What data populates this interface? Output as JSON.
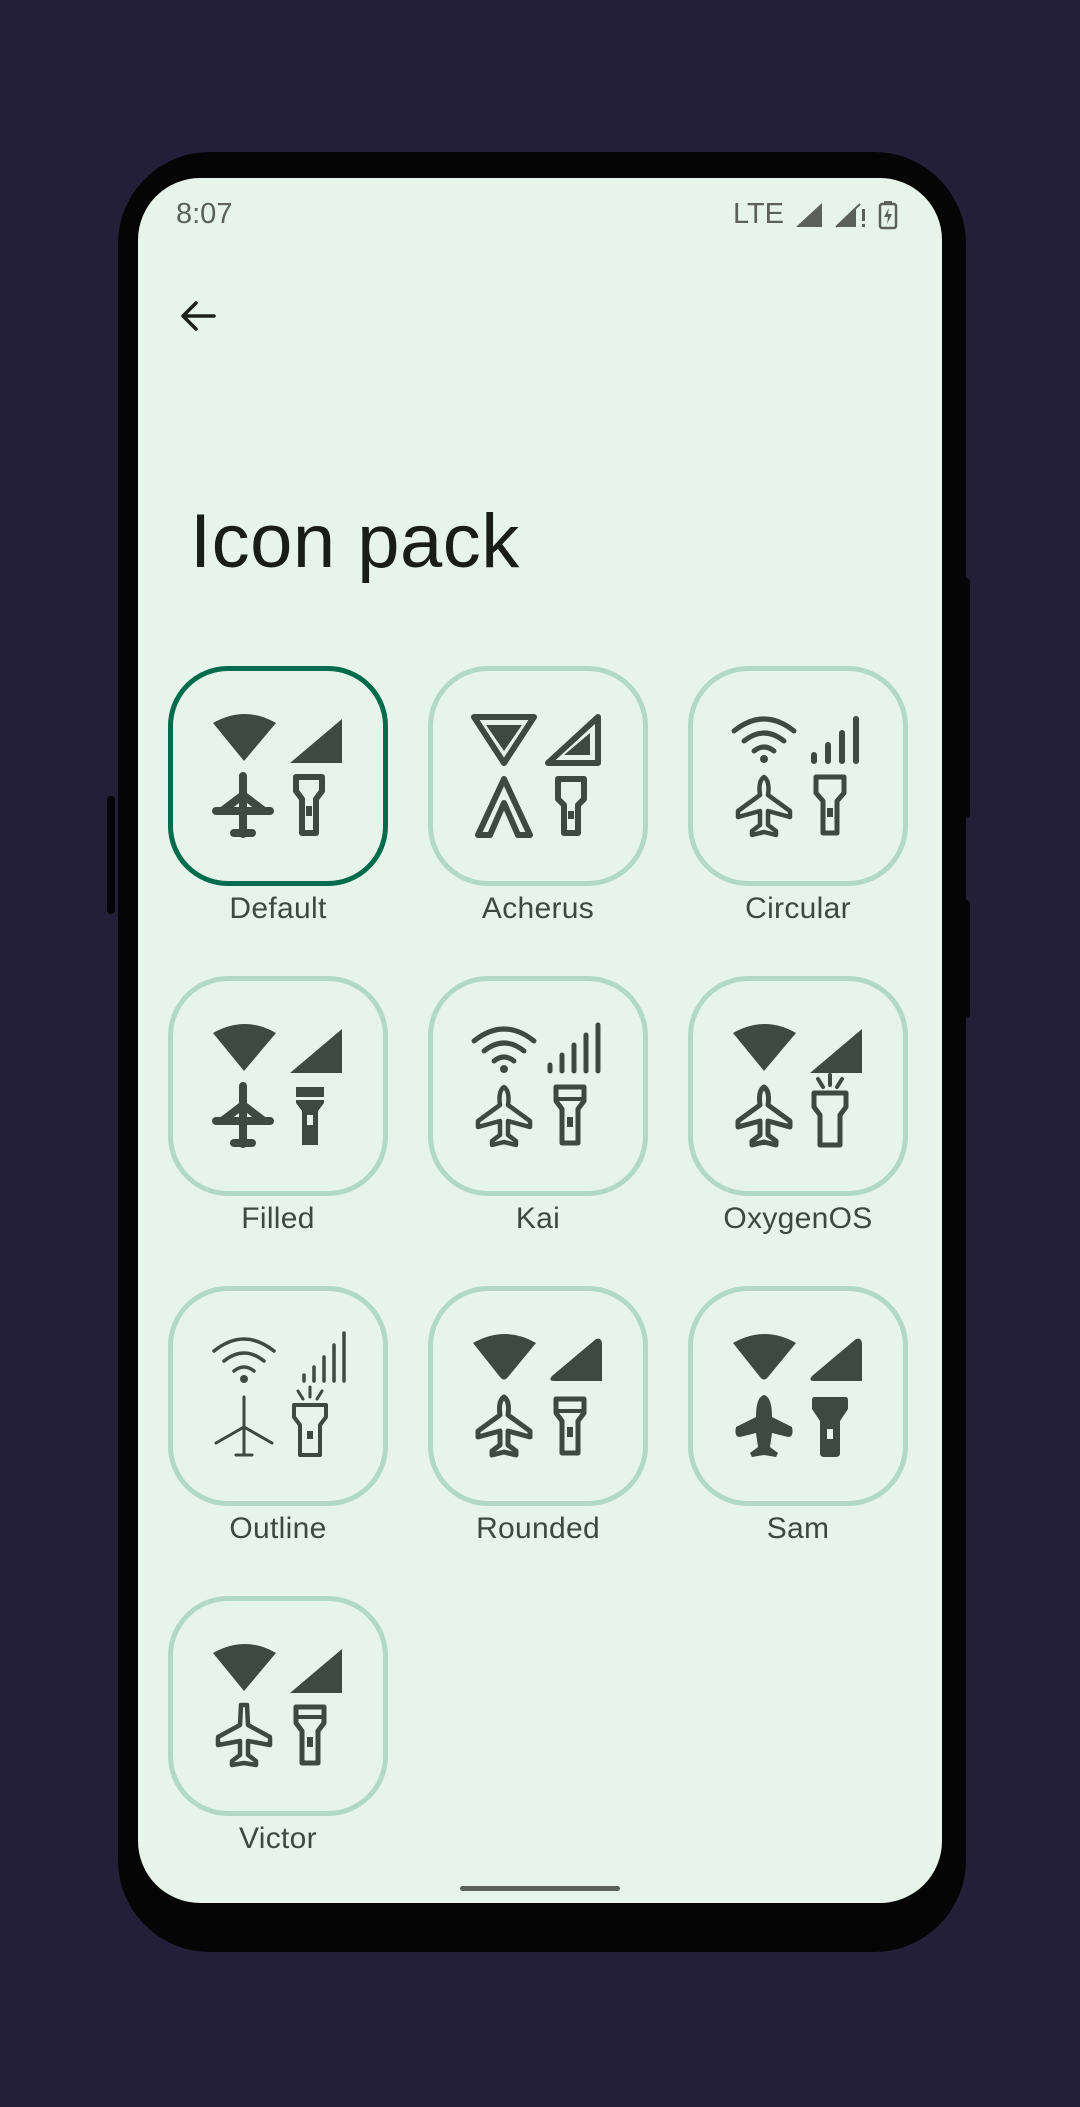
{
  "status_bar": {
    "time": "8:07",
    "network": "LTE",
    "icons": [
      "signal-full-icon",
      "signal-partial-alert-icon",
      "battery-charging-icon"
    ]
  },
  "navigation": {
    "back_icon": "arrow-left-icon"
  },
  "page": {
    "title": "Icon pack"
  },
  "colors": {
    "background": "#e6f4ec",
    "selected_border": "#006c4c",
    "tile_border": "#b2d8c6",
    "icon": "#3d4a42"
  },
  "icon_packs": [
    {
      "label": "Default",
      "selected": true
    },
    {
      "label": "Acherus",
      "selected": false
    },
    {
      "label": "Circular",
      "selected": false
    },
    {
      "label": "Filled",
      "selected": false
    },
    {
      "label": "Kai",
      "selected": false
    },
    {
      "label": "OxygenOS",
      "selected": false
    },
    {
      "label": "Outline",
      "selected": false
    },
    {
      "label": "Rounded",
      "selected": false
    },
    {
      "label": "Sam",
      "selected": false
    },
    {
      "label": "Victor",
      "selected": false
    }
  ]
}
